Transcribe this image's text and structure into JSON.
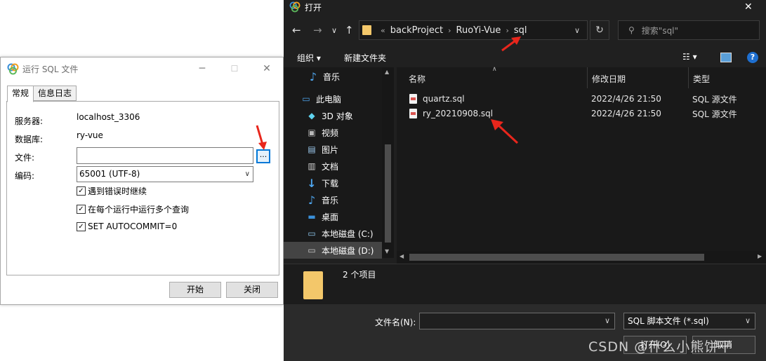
{
  "sql_dialog": {
    "title": "运行 SQL 文件",
    "controls": {
      "minimize": "─",
      "maximize": "☐",
      "close": "✕"
    },
    "tabs": [
      {
        "label": "常规"
      },
      {
        "label": "信息日志"
      }
    ],
    "fields": {
      "server_label": "服务器:",
      "server_value": "localhost_3306",
      "database_label": "数据库:",
      "database_value": "ry-vue",
      "file_label": "文件:",
      "file_value": "",
      "browse_label": "...",
      "encoding_label": "编码:",
      "encoding_value": "65001 (UTF-8)"
    },
    "checkboxes": [
      {
        "label": "遇到错误时继续",
        "checked": true
      },
      {
        "label": "在每个运行中运行多个查询",
        "checked": true
      },
      {
        "label": "SET AUTOCOMMIT=0",
        "checked": true
      }
    ],
    "buttons": {
      "start": "开始",
      "close": "关闭"
    },
    "check_mark": "✓"
  },
  "open_dialog": {
    "title": "打开",
    "controls": {
      "close": "✕"
    },
    "nav": {
      "back": "←",
      "forward": "→",
      "dropdown": "∨",
      "up": "↑"
    },
    "address": {
      "overflow": "«",
      "crumbs": [
        "backProject",
        "RuoYi-Vue",
        "sql"
      ],
      "separator": "›",
      "dropdown": "∨",
      "refresh": "↻"
    },
    "search_placeholder": "搜索\"sql\"",
    "toolbar": {
      "organize": "组织 ▾",
      "new_folder": "新建文件夹",
      "view": "☷ ▾",
      "help": "?"
    },
    "nav_pane": [
      {
        "label": "音乐",
        "icon": "♪"
      },
      {
        "label": "此电脑",
        "icon": "▭"
      },
      {
        "label": "3D 对象",
        "icon": "◆"
      },
      {
        "label": "视频",
        "icon": "▣"
      },
      {
        "label": "图片",
        "icon": "▤"
      },
      {
        "label": "文档",
        "icon": "▥"
      },
      {
        "label": "下载",
        "icon": "↓"
      },
      {
        "label": "音乐",
        "icon": "♪"
      },
      {
        "label": "桌面",
        "icon": "▬"
      },
      {
        "label": "本地磁盘 (C:)",
        "icon": "▭"
      },
      {
        "label": "本地磁盘 (D:)",
        "icon": "▭"
      }
    ],
    "columns": {
      "name": "名称",
      "modified": "修改日期",
      "type": "类型"
    },
    "files": [
      {
        "name": "quartz.sql",
        "modified": "2022/4/26 21:50",
        "type": "SQL 源文件"
      },
      {
        "name": "ry_20210908.sql",
        "modified": "2022/4/26 21:50",
        "type": "SQL 源文件"
      }
    ],
    "item_count": "2 个项目",
    "filename_label": "文件名(N):",
    "filename_value": "",
    "filetype_value": "SQL 脚本文件 (*.sql)",
    "buttons": {
      "open": "打开(O)",
      "cancel": "取消"
    }
  },
  "watermark": "CSDN @什么小熊饼干",
  "colors": {
    "annotation_red": "#e8261c",
    "dark_bg": "#202020",
    "accent_blue": "#0078d7"
  }
}
